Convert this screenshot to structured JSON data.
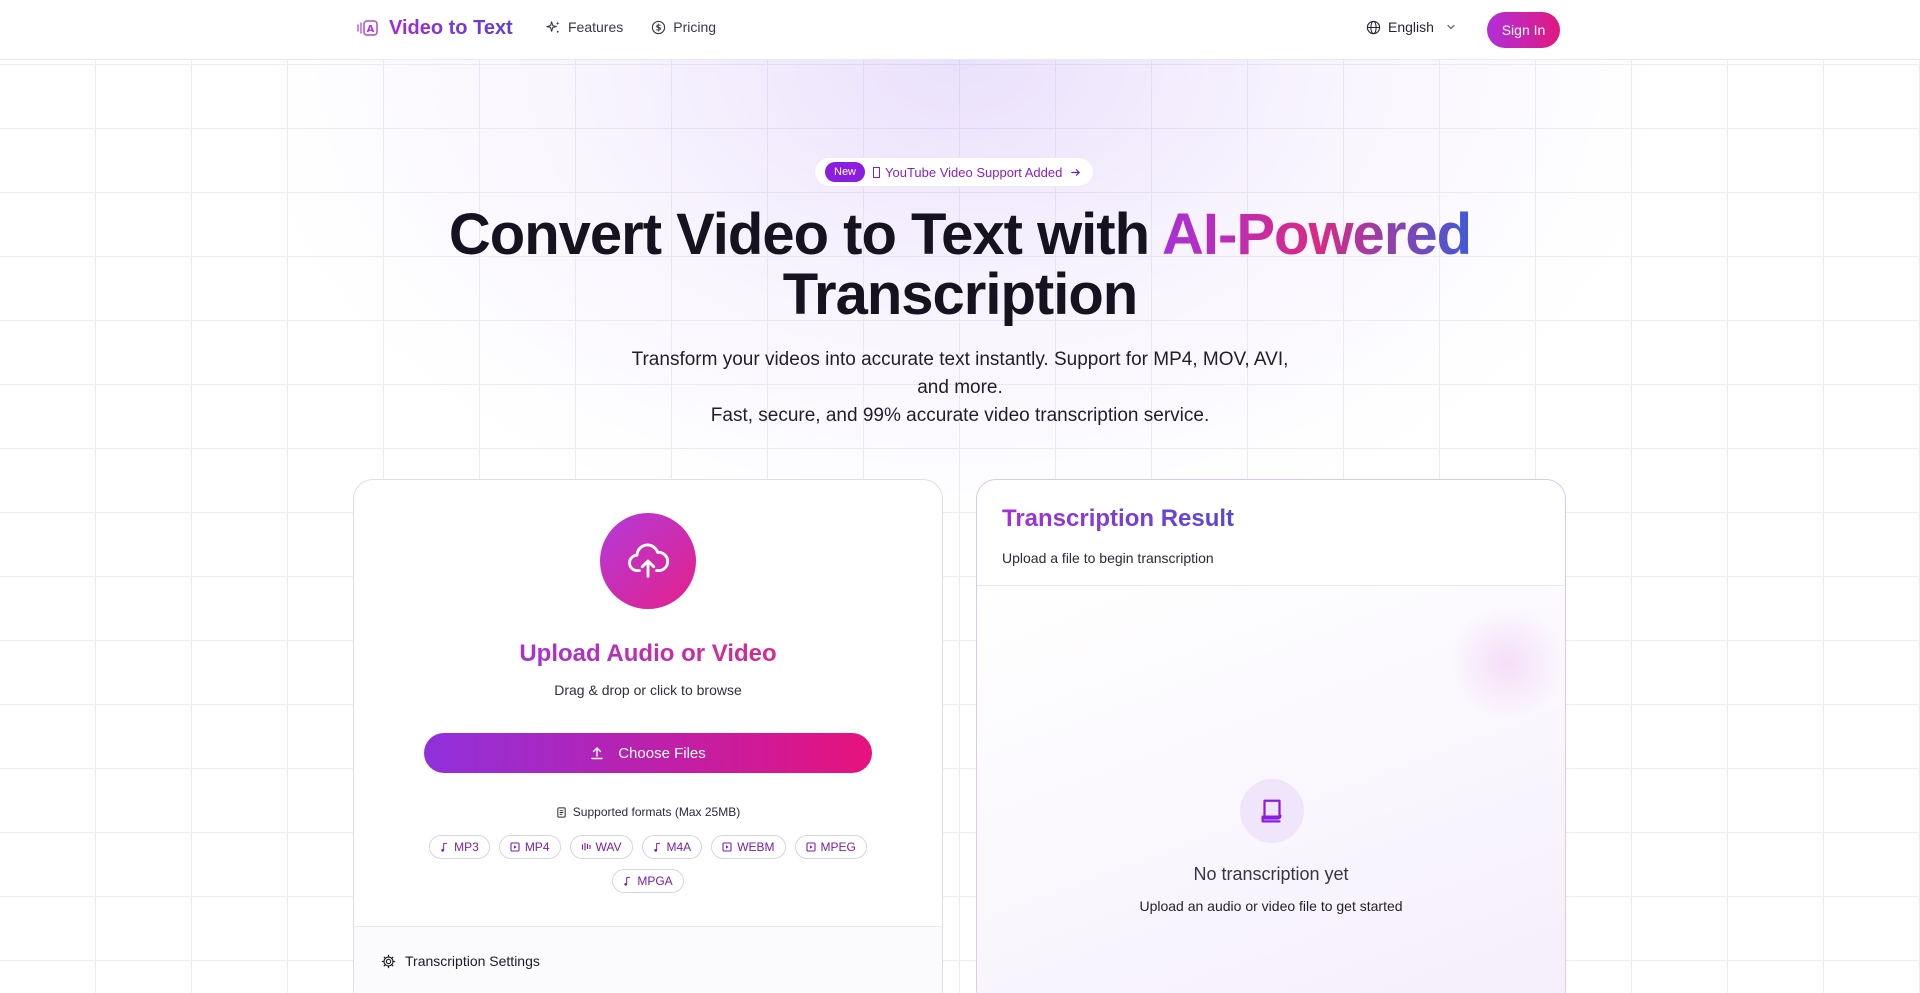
{
  "header": {
    "brand": "Video to Text",
    "nav": [
      {
        "label": "Features",
        "icon": "sparkles-icon"
      },
      {
        "label": "Pricing",
        "icon": "dollar-circle-icon"
      }
    ],
    "language": "English",
    "sign_in": "Sign In"
  },
  "hero": {
    "badge_new": "New",
    "badge_text": "YouTube Video Support Added",
    "title_prefix": "Convert Video to Text with ",
    "title_accent": "AI-Powered",
    "title_suffix": "Transcription",
    "subtitle_line1": "Transform your videos into accurate text instantly. Support for MP4, MOV, AVI, and more.",
    "subtitle_line2": "Fast, secure, and 99% accurate video transcription service."
  },
  "upload": {
    "title": "Upload Audio or Video",
    "subtitle": "Drag & drop or click to browse",
    "button": "Choose Files",
    "formats_label": "Supported formats (Max 25MB)",
    "formats": [
      {
        "label": "MP3",
        "icon": "music-note-icon"
      },
      {
        "label": "MP4",
        "icon": "video-file-icon"
      },
      {
        "label": "WAV",
        "icon": "waveform-icon"
      },
      {
        "label": "M4A",
        "icon": "music-note-icon"
      },
      {
        "label": "WEBM",
        "icon": "video-file-icon"
      },
      {
        "label": "MPEG",
        "icon": "video-file-icon"
      },
      {
        "label": "MPGA",
        "icon": "music-note-icon"
      }
    ],
    "settings_label": "Transcription Settings"
  },
  "result": {
    "title": "Transcription Result",
    "subtitle": "Upload a file to begin transcription",
    "empty_title": "No transcription yet",
    "empty_subtitle": "Upload an audio or video file to get started"
  },
  "colors": {
    "accent_purple": "#8b1de0",
    "accent_pink": "#e0197f",
    "text_dark": "#16121f"
  }
}
